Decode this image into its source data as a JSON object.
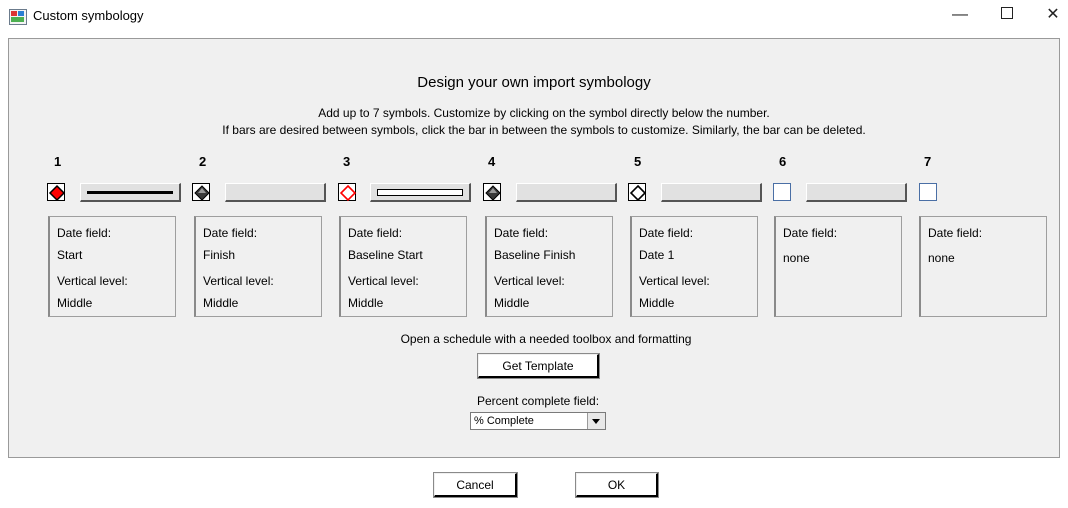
{
  "window": {
    "title": "Custom symbology",
    "icon": "custom-symbology-app-icon",
    "controls": {
      "minimize": "—",
      "maximize": "maximize-icon",
      "close": "✕"
    }
  },
  "header": {
    "heading": "Design your own import symbology",
    "instruction_1": "Add up to 7 symbols.  Customize by clicking on the symbol directly below the number.",
    "instruction_2": "If bars are desired between symbols, click the bar in between the symbols to customize.  Similarly, the bar can be deleted."
  },
  "symbols": [
    {
      "number": "1",
      "symbol_icon": "diamond-red-filled-icon",
      "bar_style": "thick-line",
      "card": {
        "date_label": "Date field:",
        "date_value": "Start",
        "level_label": "Vertical level:",
        "level_value": "Middle"
      }
    },
    {
      "number": "2",
      "symbol_icon": "diamond-dark-3d-icon",
      "bar_style": "empty",
      "card": {
        "date_label": "Date field:",
        "date_value": "Finish",
        "level_label": "Vertical level:",
        "level_value": "Middle"
      }
    },
    {
      "number": "3",
      "symbol_icon": "diamond-red-outline-icon",
      "bar_style": "hollow-bar",
      "card": {
        "date_label": "Date field:",
        "date_value": "Baseline Start",
        "level_label": "Vertical level:",
        "level_value": "Middle"
      }
    },
    {
      "number": "4",
      "symbol_icon": "diamond-dark-3d-icon",
      "bar_style": "empty",
      "card": {
        "date_label": "Date field:",
        "date_value": "Baseline Finish",
        "level_label": "Vertical level:",
        "level_value": "Middle"
      }
    },
    {
      "number": "5",
      "symbol_icon": "diamond-black-outline-icon",
      "bar_style": "empty",
      "card": {
        "date_label": "Date field:",
        "date_value": "Date 1",
        "level_label": "Vertical level:",
        "level_value": "Middle"
      }
    },
    {
      "number": "6",
      "symbol_icon": "empty-square-icon",
      "bar_style": "empty",
      "card": {
        "date_label": "Date field:",
        "date_value": "none"
      }
    },
    {
      "number": "7",
      "symbol_icon": "empty-square-icon",
      "card": {
        "date_label": "Date field:",
        "date_value": "none"
      }
    }
  ],
  "template": {
    "description": "Open a schedule with a needed toolbox and formatting",
    "button": "Get Template"
  },
  "percent_complete": {
    "label": "Percent complete field:",
    "selected": "% Complete"
  },
  "footer": {
    "cancel": "Cancel",
    "ok": "OK"
  },
  "colors": {
    "accent_red": "#ff0000",
    "dialog_bg": "#f0f0f0",
    "empty_symbol_border": "#4a6fa5"
  }
}
